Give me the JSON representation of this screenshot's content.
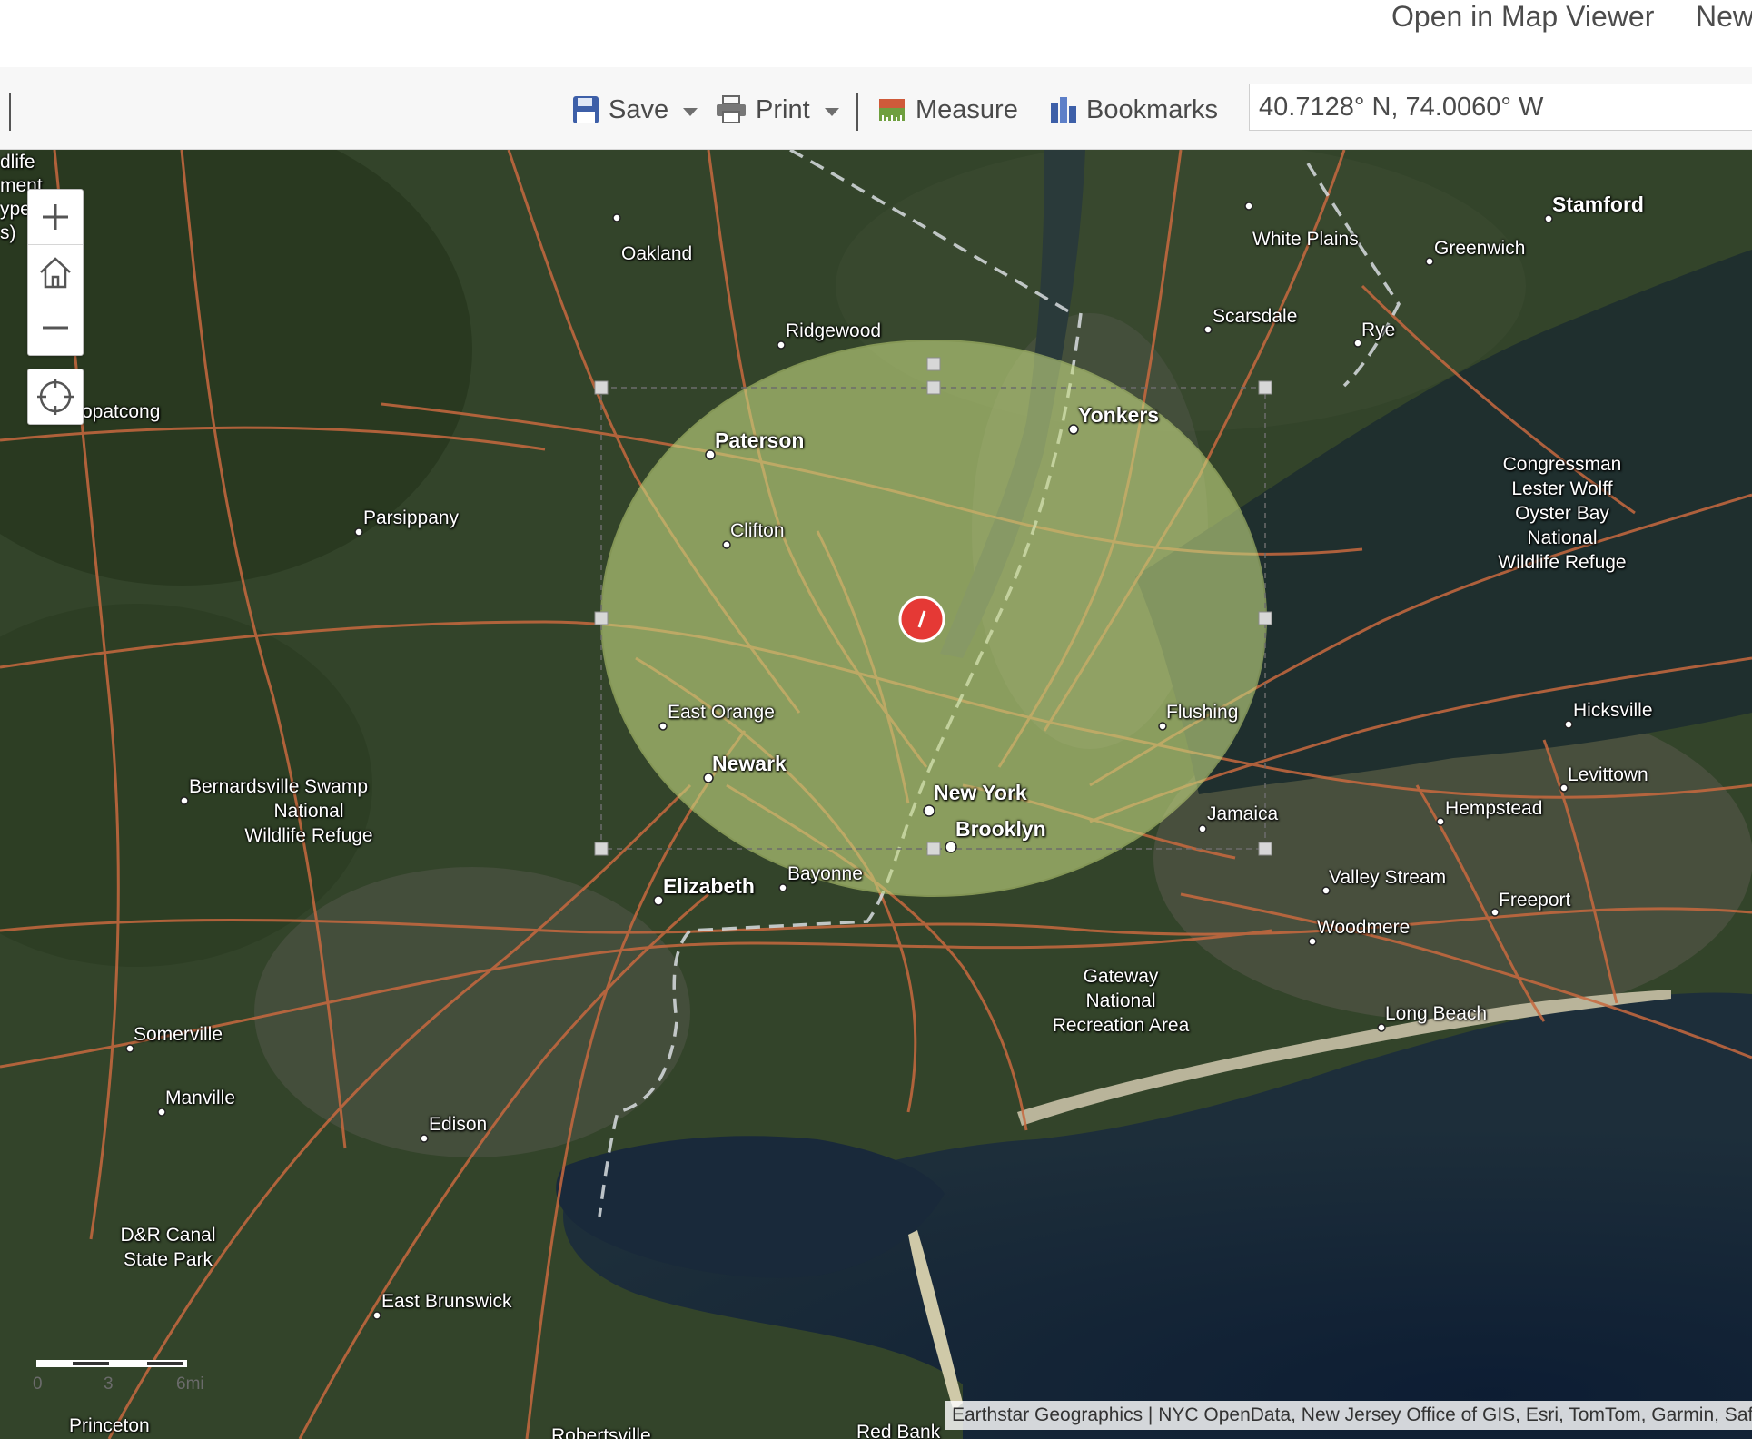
{
  "header": {
    "open_map_viewer": "Open in Map Viewer",
    "new_label": "New"
  },
  "toolbar": {
    "save": "Save",
    "print": "Print",
    "measure": "Measure",
    "bookmarks": "Bookmarks",
    "coordinates_value": "40.7128° N, 74.0060° W"
  },
  "map": {
    "basemap": "Imagery Hybrid",
    "buffer_center": "New York",
    "marker_color": "#e53935",
    "buffer_color": "#c5d982",
    "labels": {
      "wildlife_left": "dlife",
      "management_left": "ment",
      "type_left": "ype",
      "s_left": "s)",
      "lake_hopatcong": "opatcong",
      "oakland": "Oakland",
      "ridgewood": "Ridgewood",
      "paterson": "Paterson",
      "clifton": "Clifton",
      "parsippany": "Parsippany",
      "white_plains": "White Plains",
      "stamford": "Stamford",
      "greenwich": "Greenwich",
      "scarsdale": "Scarsdale",
      "rye": "Rye",
      "yonkers": "Yonkers",
      "congressman_l1": "Congressman",
      "congressman_l2": "Lester Wolff",
      "congressman_l3": "Oyster Bay",
      "congressman_l4": "National",
      "congressman_l5": "Wildlife Refuge",
      "east_orange": "East Orange",
      "newark": "Newark",
      "flushing": "Flushing",
      "hicksville": "Hicksville",
      "levittown": "Levittown",
      "new_york": "New York",
      "brooklyn": "Brooklyn",
      "jamaica": "Jamaica",
      "hempstead": "Hempstead",
      "bernardsville": "Bernardsville",
      "swamp_l1": "Swamp",
      "swamp_l2": "National",
      "swamp_l3": "Wildlife Refuge",
      "elizabeth": "Elizabeth",
      "bayonne": "Bayonne",
      "valley_stream": "Valley Stream",
      "freeport": "Freeport",
      "woodmere": "Woodmere",
      "gateway_l1": "Gateway",
      "gateway_l2": "National",
      "gateway_l3": "Recreation Area",
      "long_beach": "Long Beach",
      "somerville": "Somerville",
      "manville": "Manville",
      "edison": "Edison",
      "dr_canal_l1": "D&R Canal",
      "dr_canal_l2": "State Park",
      "east_brunswick": "East Brunswick",
      "princeton": "Princeton",
      "robertsville": "Robertsville",
      "red_bank": "Red Bank"
    },
    "scale": {
      "zero": "0",
      "mid": "3",
      "end": "6mi"
    },
    "attribution": "Earthstar Geographics | NYC OpenData, New Jersey Office of GIS, Esri, TomTom, Garmin, SafeGraph"
  }
}
